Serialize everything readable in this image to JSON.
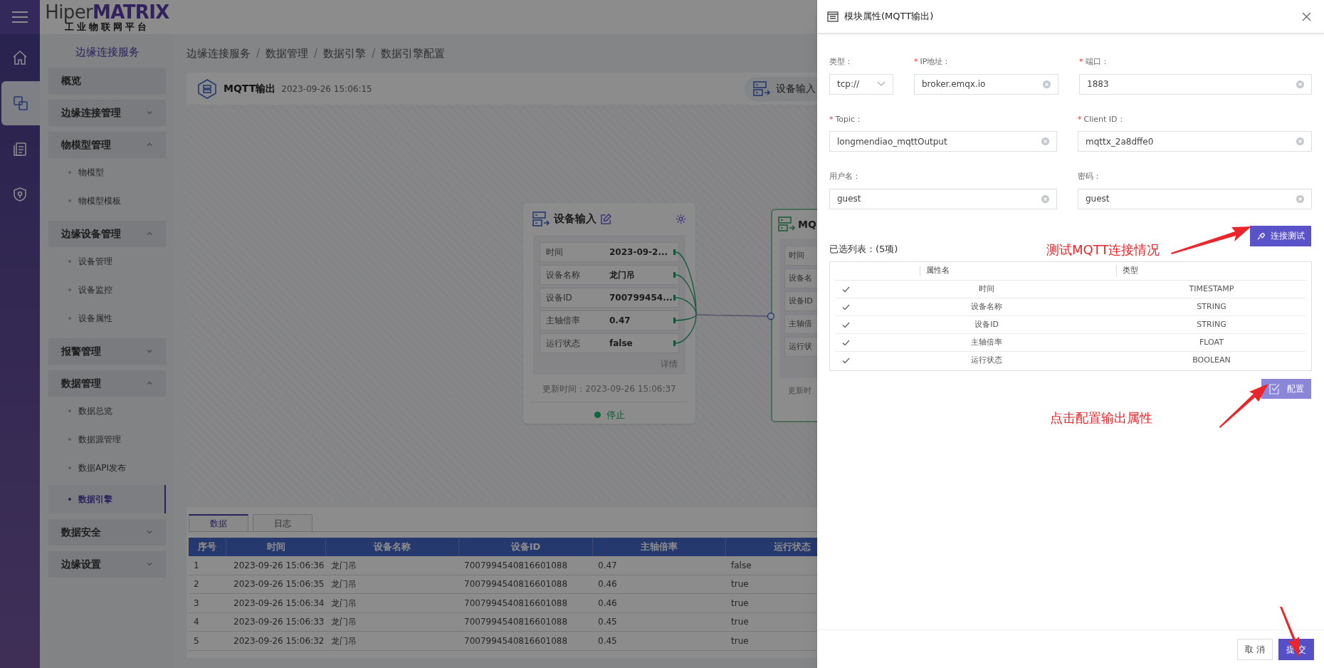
{
  "logo": {
    "brand_light": "Hiper",
    "brand_bold": "MATRIX",
    "subtitle": "工业物联网平台"
  },
  "rail": [
    {
      "kind": "home",
      "selected": false
    },
    {
      "kind": "link",
      "selected": true
    },
    {
      "kind": "document",
      "selected": false
    },
    {
      "kind": "shield",
      "selected": false
    }
  ],
  "sidebar": {
    "title": "边缘连接服务",
    "items": [
      {
        "label": "概览",
        "selected": false
      },
      {
        "label": "边缘连接管理",
        "expanded": false,
        "selected": false
      },
      {
        "label": "物模型管理",
        "expanded": true,
        "selected": false,
        "children": [
          {
            "label": "物模型",
            "selected": false
          },
          {
            "label": "物模型模板",
            "selected": false
          }
        ]
      },
      {
        "label": "边缘设备管理",
        "expanded": true,
        "selected": false,
        "children": [
          {
            "label": "设备管理",
            "selected": false
          },
          {
            "label": "设备监控",
            "selected": false
          },
          {
            "label": "设备属性",
            "selected": false
          }
        ]
      },
      {
        "label": "报警管理",
        "expanded": false,
        "selected": false
      },
      {
        "label": "数据管理",
        "expanded": true,
        "selected": false,
        "children": [
          {
            "label": "数据总览",
            "selected": false
          },
          {
            "label": "数据源管理",
            "selected": false
          },
          {
            "label": "数据API发布",
            "selected": false
          },
          {
            "label": "数据引擎",
            "selected": true
          }
        ]
      },
      {
        "label": "数据安全",
        "expanded": false,
        "selected": false
      },
      {
        "label": "边缘设置",
        "expanded": false,
        "selected": false
      }
    ]
  },
  "breadcrumb": [
    {
      "label": "边缘连接服务"
    },
    {
      "separator": "/",
      "label": "数据管理"
    },
    {
      "separator": "/",
      "label": "数据引擎"
    },
    {
      "separator": "/",
      "label": "数据引擎配置"
    }
  ],
  "header": {
    "title": "MQTT输出",
    "time": "2023-09-26 15:06:15",
    "node_button": "设备输入"
  },
  "source_node": {
    "title": "设备输入",
    "rows": [
      {
        "label": "时间",
        "value": "2023-09-2..."
      },
      {
        "label": "设备名称",
        "value": "龙门吊"
      },
      {
        "label": "设备ID",
        "value": "700799454..."
      },
      {
        "label": "主轴倍率",
        "value": "0.47"
      },
      {
        "label": "运行状态",
        "value": "false"
      }
    ],
    "detail_link": "详情",
    "updated": "更新时间：2023-09-26 15:06:37",
    "status": "停止"
  },
  "target_node": {
    "title": "MQ",
    "rows": [
      "时间",
      "设备名",
      "设备ID",
      "主轴倍",
      "运行状"
    ],
    "updated": "更新时"
  },
  "bottom": {
    "tabs": [
      {
        "label": "数据",
        "selected": true
      },
      {
        "label": "日志",
        "selected": false
      }
    ],
    "columns": [
      "序号",
      "时间",
      "设备名称",
      "设备ID",
      "主轴倍率",
      "运行状态"
    ],
    "rows": [
      [
        "1",
        "2023-09-26 15:06:36",
        "龙门吊",
        "7007994540816601088",
        "0.47",
        "false"
      ],
      [
        "2",
        "2023-09-26 15:06:35",
        "龙门吊",
        "7007994540816601088",
        "0.46",
        "true"
      ],
      [
        "3",
        "2023-09-26 15:06:34",
        "龙门吊",
        "7007994540816601088",
        "0.46",
        "true"
      ],
      [
        "4",
        "2023-09-26 15:06:33",
        "龙门吊",
        "7007994540816601088",
        "0.45",
        "true"
      ],
      [
        "5",
        "2023-09-26 15:06:32",
        "龙门吊",
        "7007994540816601088",
        "0.45",
        "true"
      ]
    ]
  },
  "drawer": {
    "title": "模块属性(MQTT输出)",
    "form_rows": [
      [
        {
          "kind": "select",
          "label": "类型：",
          "value": "tcp://"
        },
        {
          "kind": "text",
          "required_mark": "*",
          "label": "IP地址：",
          "value": "broker.emqx.io"
        },
        {
          "kind": "text",
          "required_mark": "*",
          "label": "端口：",
          "value": "1883"
        }
      ],
      [
        {
          "kind": "text",
          "required_mark": "*",
          "label": "Topic：",
          "value": "longmendiao_mqttOutput"
        },
        {
          "kind": "text",
          "required_mark": "*",
          "label": "Client ID：",
          "value": "mqttx_2a8dffe0"
        }
      ],
      [
        {
          "kind": "text",
          "label": "用户名：",
          "value": "guest"
        },
        {
          "kind": "text",
          "label": "密码：",
          "value": "guest"
        }
      ]
    ],
    "test_button": "连接测试",
    "list_title": "已选列表：(5项)",
    "list_columns": [
      "属性名",
      "类型"
    ],
    "list_rows": [
      {
        "checked": true,
        "name": "时间",
        "type": "TIMESTAMP"
      },
      {
        "checked": true,
        "name": "设备名称",
        "type": "STRING"
      },
      {
        "checked": true,
        "name": "设备ID",
        "type": "STRING"
      },
      {
        "checked": true,
        "name": "主轴倍率",
        "type": "FLOAT"
      },
      {
        "checked": true,
        "name": "运行状态",
        "type": "BOOLEAN"
      }
    ],
    "config_button": "配置",
    "cancel_button": "取 消",
    "submit_button": "提 交"
  },
  "annotations": [
    {
      "text": "测试MQTT连接情况"
    },
    {
      "text": "点击配置输出属性"
    }
  ]
}
